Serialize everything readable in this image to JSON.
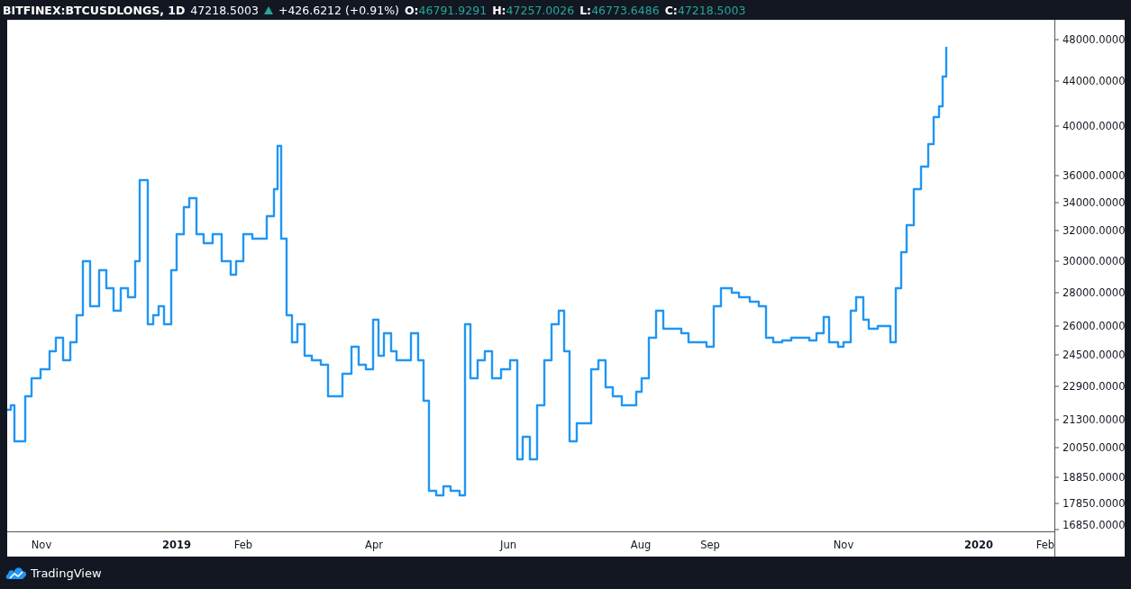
{
  "header": {
    "symbol": "BITFINEX:BTCUSDLONGS, 1D",
    "last": "47218.5003",
    "change": "+426.6212 (+0.91%)",
    "ohlc": [
      {
        "label": "O:",
        "value": "46791.9291"
      },
      {
        "label": "H:",
        "value": "47257.0026"
      },
      {
        "label": "L:",
        "value": "46773.6486"
      },
      {
        "label": "C:",
        "value": "47218.5003"
      }
    ]
  },
  "chart": {
    "price_axis": [
      "48000.0000",
      "44000.0000",
      "40000.0000",
      "36000.0000",
      "34000.0000",
      "32000.0000",
      "30000.0000",
      "28000.0000",
      "26000.0000",
      "24500.0000",
      "22900.0000",
      "21300.0000",
      "20050.0000",
      "18850.0000",
      "17850.0000",
      "16850.0000"
    ],
    "time_axis": [
      {
        "label": "Nov",
        "kind": "month"
      },
      {
        "label": "2019",
        "kind": "year"
      },
      {
        "label": "Feb",
        "kind": "month"
      },
      {
        "label": "Apr",
        "kind": "month"
      },
      {
        "label": "Jun",
        "kind": "month"
      },
      {
        "label": "Aug",
        "kind": "month"
      },
      {
        "label": "Sep",
        "kind": "month"
      },
      {
        "label": "Nov",
        "kind": "month"
      },
      {
        "label": "2020",
        "kind": "year"
      },
      {
        "label": "Feb",
        "kind": "month"
      }
    ]
  },
  "footer": {
    "brand": "TradingView"
  }
}
